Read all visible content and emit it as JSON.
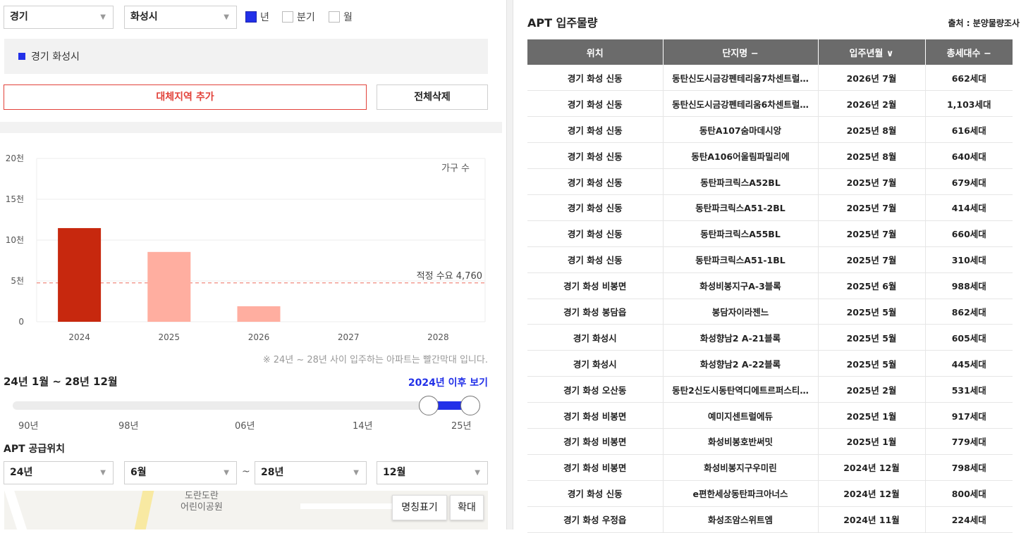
{
  "filters": {
    "province": "경기",
    "city": "화성시",
    "period_options": [
      {
        "label": "년",
        "checked": true
      },
      {
        "label": "분기",
        "checked": false
      },
      {
        "label": "월",
        "checked": false
      }
    ]
  },
  "region_tag": "경기 화성시",
  "buttons": {
    "add_region": "대체지역 추가",
    "delete_all": "전체삭제"
  },
  "colors": {
    "accent_blue": "#2230e8",
    "bar_dark": "#c7280e",
    "bar_light": "#ffaea0",
    "demand_line": "#f08a7e"
  },
  "chart_data": {
    "type": "bar",
    "categories": [
      "2024",
      "2025",
      "2026",
      "2027",
      "2028"
    ],
    "values": [
      11470,
      8550,
      1900,
      0,
      0
    ],
    "highlight_index": 0,
    "ylim": [
      0,
      20000
    ],
    "yticks": [
      "0",
      "5천",
      "10천",
      "15천",
      "20천"
    ],
    "ytick_values": [
      0,
      5000,
      10000,
      15000,
      20000
    ],
    "unit_label": "가구 수",
    "reference_line": {
      "label": "적정 수요 4,760",
      "value": 4760
    },
    "grid": true
  },
  "chart_note": "※ 24년 ~ 28년 사이 입주하는 아파트는 빨간막대 입니다.",
  "range": {
    "title": "24년 1월 ~ 28년 12월",
    "link": "2024년 이후 보기",
    "tick_labels": [
      "90년",
      "98년",
      "06년",
      "14년",
      "25년"
    ]
  },
  "supply": {
    "title": "APT 공급위치",
    "from_year": "24년",
    "from_month": "6월",
    "separator": "~",
    "to_year": "28년",
    "to_month": "12월"
  },
  "map": {
    "park_label": "도란도란\n어린이공원",
    "name_toggle": "명칭표기",
    "zoom": "확대"
  },
  "table": {
    "title": "APT 입주물량",
    "source": "출처 : 분양물량조사",
    "headers": [
      "위치",
      "단지명 −",
      "입주년월 ∨",
      "총세대수 −"
    ],
    "rows": [
      [
        "경기 화성 신동",
        "동탄신도시금강펜테리움7차센트럴…",
        "2026년 7월",
        "662세대"
      ],
      [
        "경기 화성 신동",
        "동탄신도시금강펜테리움6차센트럴…",
        "2026년 2월",
        "1,103세대"
      ],
      [
        "경기 화성 신동",
        "동탄A107숨마데시앙",
        "2025년 8월",
        "616세대"
      ],
      [
        "경기 화성 신동",
        "동탄A106어울림파밀리에",
        "2025년 8월",
        "640세대"
      ],
      [
        "경기 화성 신동",
        "동탄파크릭스A52BL",
        "2025년 7월",
        "679세대"
      ],
      [
        "경기 화성 신동",
        "동탄파크릭스A51-2BL",
        "2025년 7월",
        "414세대"
      ],
      [
        "경기 화성 신동",
        "동탄파크릭스A55BL",
        "2025년 7월",
        "660세대"
      ],
      [
        "경기 화성 신동",
        "동탄파크릭스A51-1BL",
        "2025년 7월",
        "310세대"
      ],
      [
        "경기 화성 비봉면",
        "화성비봉지구A-3블록",
        "2025년 6월",
        "988세대"
      ],
      [
        "경기 화성 봉담읍",
        "봉담자이라젠느",
        "2025년 5월",
        "862세대"
      ],
      [
        "경기 화성시",
        "화성향남2 A-21블록",
        "2025년 5월",
        "605세대"
      ],
      [
        "경기 화성시",
        "화성향남2 A-22블록",
        "2025년 5월",
        "445세대"
      ],
      [
        "경기 화성 오산동",
        "동탄2신도시동탄역디에트르퍼스티…",
        "2025년 2월",
        "531세대"
      ],
      [
        "경기 화성 비봉면",
        "예미지센트럴에듀",
        "2025년 1월",
        "917세대"
      ],
      [
        "경기 화성 비봉면",
        "화성비봉호반써밋",
        "2025년 1월",
        "779세대"
      ],
      [
        "경기 화성 비봉면",
        "화성비봉지구우미린",
        "2024년 12월",
        "798세대"
      ],
      [
        "경기 화성 신동",
        "e편한세상동탄파크아너스",
        "2024년 12월",
        "800세대"
      ],
      [
        "경기 화성 우정읍",
        "화성조암스위트엠",
        "2024년 11월",
        "224세대"
      ]
    ]
  }
}
